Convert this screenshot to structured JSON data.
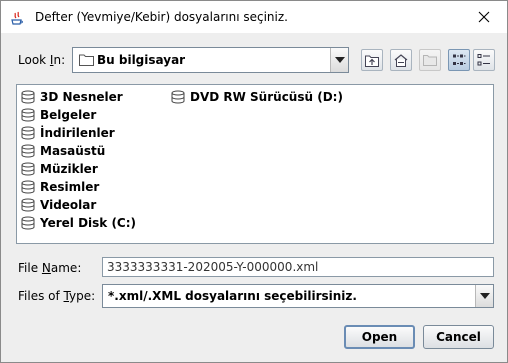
{
  "window": {
    "title": "Defter (Yevmiye/Kebir) dosyalarını seçiniz."
  },
  "look_in": {
    "label_prefix": "Look ",
    "label_mnemonic": "I",
    "label_suffix": "n:",
    "value": "Bu bilgisayar"
  },
  "toolbar": {
    "icons": [
      "up-folder-icon",
      "home-icon",
      "new-folder-icon",
      "list-view-icon",
      "details-view-icon"
    ]
  },
  "files": {
    "column1": [
      "3D Nesneler",
      "Belgeler",
      "İndirilenler",
      "Masaüstü",
      "Müzikler",
      "Resimler",
      "Videolar",
      "Yerel Disk (C:)"
    ],
    "column2": [
      "DVD RW Sürücüsü (D:)"
    ]
  },
  "file_name": {
    "label_prefix": "File ",
    "label_mnemonic": "N",
    "label_suffix": "ame:",
    "value": "3333333331-202005-Y-000000.xml"
  },
  "file_type": {
    "label_prefix": "Files of ",
    "label_mnemonic": "T",
    "label_suffix": "ype:",
    "value": "*.xml/.XML dosyalarını seçebilirsiniz."
  },
  "buttons": {
    "open": "Open",
    "cancel": "Cancel"
  },
  "colors": {
    "dialog_bg": "#eeeeee",
    "selection_border": "#6a8cb4"
  }
}
